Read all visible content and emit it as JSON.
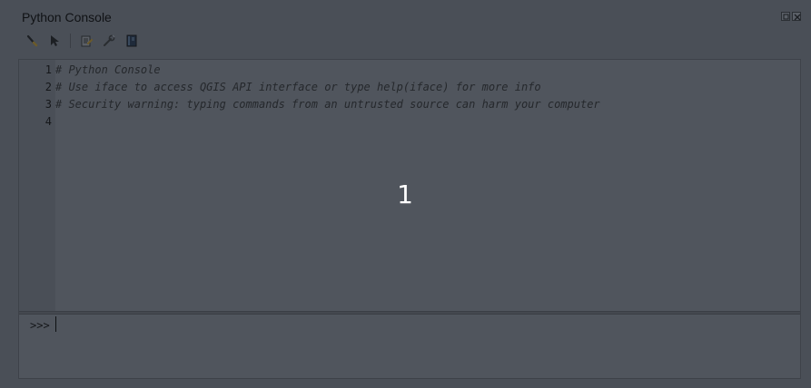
{
  "window": {
    "title": "Python Console"
  },
  "toolbar": {
    "items": [
      {
        "icon": "clear-console-icon"
      },
      {
        "icon": "run-command-icon"
      },
      {
        "icon": "show-editor-icon"
      },
      {
        "icon": "options-icon"
      },
      {
        "icon": "help-icon"
      }
    ]
  },
  "editor": {
    "lines": [
      {
        "number": "1",
        "text": "# Python Console"
      },
      {
        "number": "2",
        "text": "# Use iface to access QGIS API interface or type help(iface) for more info"
      },
      {
        "number": "3",
        "text": "# Security warning: typing commands from an untrusted source can harm your computer"
      },
      {
        "number": "4",
        "text": ""
      }
    ]
  },
  "input": {
    "prompt": ">>>",
    "value": ""
  },
  "overlay": {
    "step_number": "1"
  }
}
